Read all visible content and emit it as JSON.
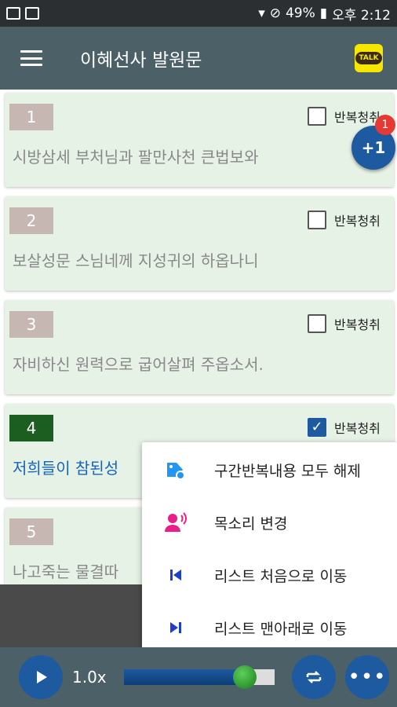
{
  "status": {
    "battery": "49%",
    "time": "오후 2:12"
  },
  "appbar": {
    "title": "이혜선사 발원문"
  },
  "items": [
    {
      "num": "1",
      "text": "시방삼세 부처님과 팔만사천 큰법보와",
      "checked": false
    },
    {
      "num": "2",
      "text": "보살성문 스님네께 지성귀의 하옵나니",
      "checked": false
    },
    {
      "num": "3",
      "text": "자비하신 원력으로 굽어살펴 주옵소서.",
      "checked": false
    },
    {
      "num": "4",
      "text": "저희들이 참된성",
      "checked": true
    },
    {
      "num": "5",
      "text": "나고죽는 물결따",
      "checked": false
    }
  ],
  "repeat_label": "반복청취",
  "fab": {
    "label": "+1",
    "badge": "1"
  },
  "menu": [
    {
      "icon": "tag-icon",
      "label": "구간반복내용 모두 해제"
    },
    {
      "icon": "voice-icon",
      "label": "목소리 변경"
    },
    {
      "icon": "skip-previous-icon",
      "label": "리스트 처음으로 이동"
    },
    {
      "icon": "skip-next-icon",
      "label": "리스트 맨아래로 이동"
    }
  ],
  "player": {
    "speed": "1.0x",
    "progress": 0.8
  },
  "colors": {
    "primary": "#1e5aa0",
    "appbar": "#4c6068",
    "card": "#e6f2e6",
    "active_num": "#1b5e20"
  }
}
